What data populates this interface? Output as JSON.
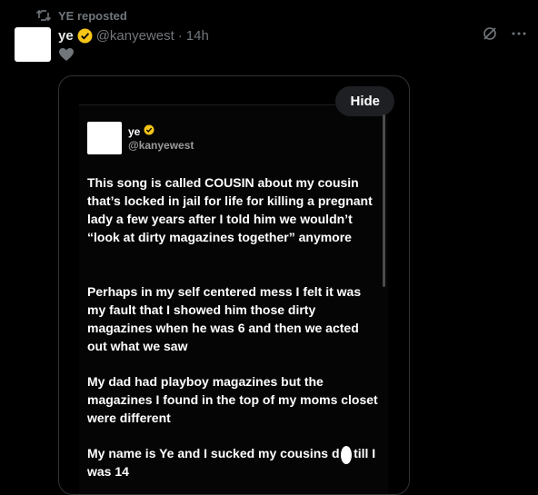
{
  "repost": {
    "icon": "repost-icon",
    "label": "YE reposted"
  },
  "post": {
    "author_name": "ye",
    "handle": "@kanyewest",
    "separator": "·",
    "time": "14h",
    "verified_color": "#f5c518"
  },
  "actions": {
    "grok_icon": "grok-icon",
    "more_icon": "more-icon",
    "heart_icon": "heart-icon"
  },
  "media": {
    "hide_label": "Hide",
    "inner_name": "ye",
    "inner_handle": "@kanyewest",
    "paragraphs": [
      "This song is called COUSIN about my cousin that’s locked in jail for life for killing a pregnant lady a few years after I told him we wouldn’t “look at dirty magazines together” anymore",
      "Perhaps in my self centered mess I felt it was my fault that I showed him those dirty magazines when he was 6 and then we acted out what we saw",
      "My dad had playboy magazines but the magazines I found in the top of my moms closet were different",
      "My name is Ye and I sucked my cousins d  k till I was 14"
    ]
  },
  "colors": {
    "background": "#000000",
    "text": "#e7e9ea",
    "muted": "#71767b",
    "verified": "#f5c518"
  }
}
